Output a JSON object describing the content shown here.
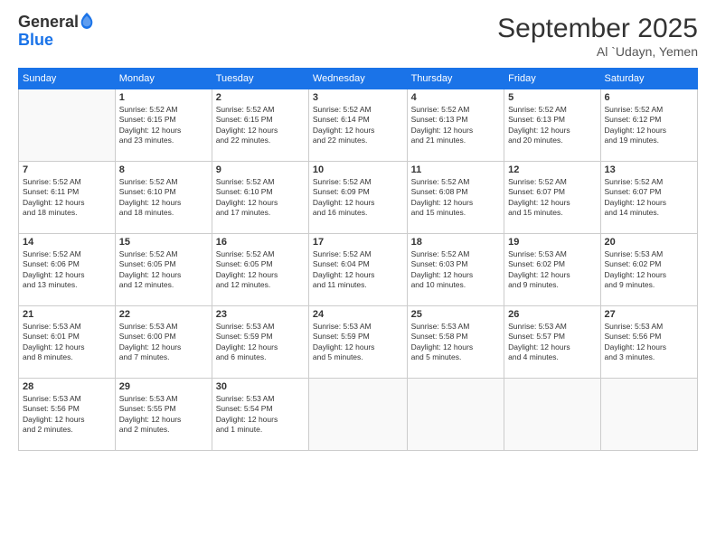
{
  "logo": {
    "line1": "General",
    "line2": "Blue"
  },
  "title": "September 2025",
  "location": "Al `Udayn, Yemen",
  "days_of_week": [
    "Sunday",
    "Monday",
    "Tuesday",
    "Wednesday",
    "Thursday",
    "Friday",
    "Saturday"
  ],
  "weeks": [
    [
      {
        "day": "",
        "info": ""
      },
      {
        "day": "1",
        "info": "Sunrise: 5:52 AM\nSunset: 6:15 PM\nDaylight: 12 hours\nand 23 minutes."
      },
      {
        "day": "2",
        "info": "Sunrise: 5:52 AM\nSunset: 6:15 PM\nDaylight: 12 hours\nand 22 minutes."
      },
      {
        "day": "3",
        "info": "Sunrise: 5:52 AM\nSunset: 6:14 PM\nDaylight: 12 hours\nand 22 minutes."
      },
      {
        "day": "4",
        "info": "Sunrise: 5:52 AM\nSunset: 6:13 PM\nDaylight: 12 hours\nand 21 minutes."
      },
      {
        "day": "5",
        "info": "Sunrise: 5:52 AM\nSunset: 6:13 PM\nDaylight: 12 hours\nand 20 minutes."
      },
      {
        "day": "6",
        "info": "Sunrise: 5:52 AM\nSunset: 6:12 PM\nDaylight: 12 hours\nand 19 minutes."
      }
    ],
    [
      {
        "day": "7",
        "info": "Sunrise: 5:52 AM\nSunset: 6:11 PM\nDaylight: 12 hours\nand 18 minutes."
      },
      {
        "day": "8",
        "info": "Sunrise: 5:52 AM\nSunset: 6:10 PM\nDaylight: 12 hours\nand 18 minutes."
      },
      {
        "day": "9",
        "info": "Sunrise: 5:52 AM\nSunset: 6:10 PM\nDaylight: 12 hours\nand 17 minutes."
      },
      {
        "day": "10",
        "info": "Sunrise: 5:52 AM\nSunset: 6:09 PM\nDaylight: 12 hours\nand 16 minutes."
      },
      {
        "day": "11",
        "info": "Sunrise: 5:52 AM\nSunset: 6:08 PM\nDaylight: 12 hours\nand 15 minutes."
      },
      {
        "day": "12",
        "info": "Sunrise: 5:52 AM\nSunset: 6:07 PM\nDaylight: 12 hours\nand 15 minutes."
      },
      {
        "day": "13",
        "info": "Sunrise: 5:52 AM\nSunset: 6:07 PM\nDaylight: 12 hours\nand 14 minutes."
      }
    ],
    [
      {
        "day": "14",
        "info": "Sunrise: 5:52 AM\nSunset: 6:06 PM\nDaylight: 12 hours\nand 13 minutes."
      },
      {
        "day": "15",
        "info": "Sunrise: 5:52 AM\nSunset: 6:05 PM\nDaylight: 12 hours\nand 12 minutes."
      },
      {
        "day": "16",
        "info": "Sunrise: 5:52 AM\nSunset: 6:05 PM\nDaylight: 12 hours\nand 12 minutes."
      },
      {
        "day": "17",
        "info": "Sunrise: 5:52 AM\nSunset: 6:04 PM\nDaylight: 12 hours\nand 11 minutes."
      },
      {
        "day": "18",
        "info": "Sunrise: 5:52 AM\nSunset: 6:03 PM\nDaylight: 12 hours\nand 10 minutes."
      },
      {
        "day": "19",
        "info": "Sunrise: 5:53 AM\nSunset: 6:02 PM\nDaylight: 12 hours\nand 9 minutes."
      },
      {
        "day": "20",
        "info": "Sunrise: 5:53 AM\nSunset: 6:02 PM\nDaylight: 12 hours\nand 9 minutes."
      }
    ],
    [
      {
        "day": "21",
        "info": "Sunrise: 5:53 AM\nSunset: 6:01 PM\nDaylight: 12 hours\nand 8 minutes."
      },
      {
        "day": "22",
        "info": "Sunrise: 5:53 AM\nSunset: 6:00 PM\nDaylight: 12 hours\nand 7 minutes."
      },
      {
        "day": "23",
        "info": "Sunrise: 5:53 AM\nSunset: 5:59 PM\nDaylight: 12 hours\nand 6 minutes."
      },
      {
        "day": "24",
        "info": "Sunrise: 5:53 AM\nSunset: 5:59 PM\nDaylight: 12 hours\nand 5 minutes."
      },
      {
        "day": "25",
        "info": "Sunrise: 5:53 AM\nSunset: 5:58 PM\nDaylight: 12 hours\nand 5 minutes."
      },
      {
        "day": "26",
        "info": "Sunrise: 5:53 AM\nSunset: 5:57 PM\nDaylight: 12 hours\nand 4 minutes."
      },
      {
        "day": "27",
        "info": "Sunrise: 5:53 AM\nSunset: 5:56 PM\nDaylight: 12 hours\nand 3 minutes."
      }
    ],
    [
      {
        "day": "28",
        "info": "Sunrise: 5:53 AM\nSunset: 5:56 PM\nDaylight: 12 hours\nand 2 minutes."
      },
      {
        "day": "29",
        "info": "Sunrise: 5:53 AM\nSunset: 5:55 PM\nDaylight: 12 hours\nand 2 minutes."
      },
      {
        "day": "30",
        "info": "Sunrise: 5:53 AM\nSunset: 5:54 PM\nDaylight: 12 hours\nand 1 minute."
      },
      {
        "day": "",
        "info": ""
      },
      {
        "day": "",
        "info": ""
      },
      {
        "day": "",
        "info": ""
      },
      {
        "day": "",
        "info": ""
      }
    ]
  ]
}
